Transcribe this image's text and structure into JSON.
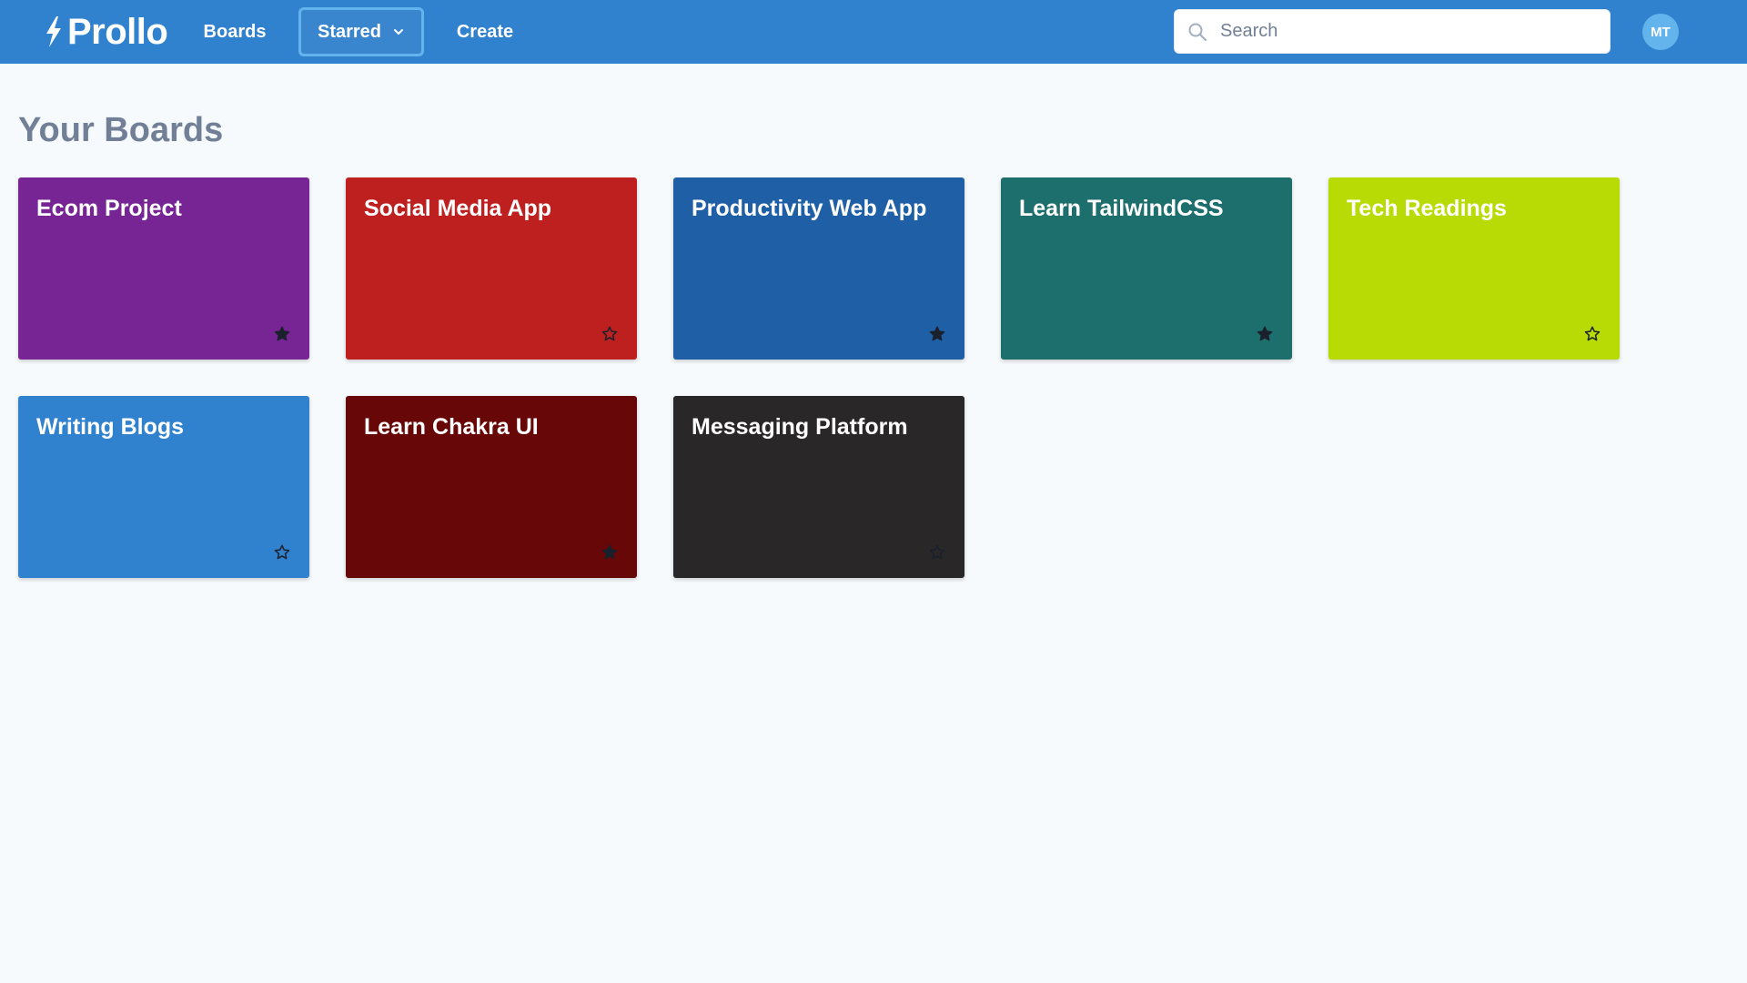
{
  "app": {
    "name": "Prollo",
    "colors": {
      "header": "#3182ce",
      "background": "#f7fafc",
      "title": "#718096",
      "star": "#1a202c"
    }
  },
  "nav": {
    "boards_label": "Boards",
    "starred_label": "Starred",
    "create_label": "Create"
  },
  "search": {
    "placeholder": "Search",
    "value": ""
  },
  "user": {
    "initials": "MT"
  },
  "page": {
    "title": "Your Boards"
  },
  "boards": [
    {
      "title": "Ecom Project",
      "color": "#772494",
      "starred": true
    },
    {
      "title": "Social Media App",
      "color": "#be2020",
      "starred": false
    },
    {
      "title": "Productivity Web App",
      "color": "#1f5fa5",
      "starred": true
    },
    {
      "title": "Learn TailwindCSS",
      "color": "#1d6f6d",
      "starred": true
    },
    {
      "title": "Tech Readings",
      "color": "#b8db05",
      "starred": false
    },
    {
      "title": "Writing Blogs",
      "color": "#3182ce",
      "starred": false
    },
    {
      "title": "Learn Chakra UI",
      "color": "#670707",
      "starred": true
    },
    {
      "title": "Messaging Platform",
      "color": "#292728",
      "starred": false
    }
  ]
}
